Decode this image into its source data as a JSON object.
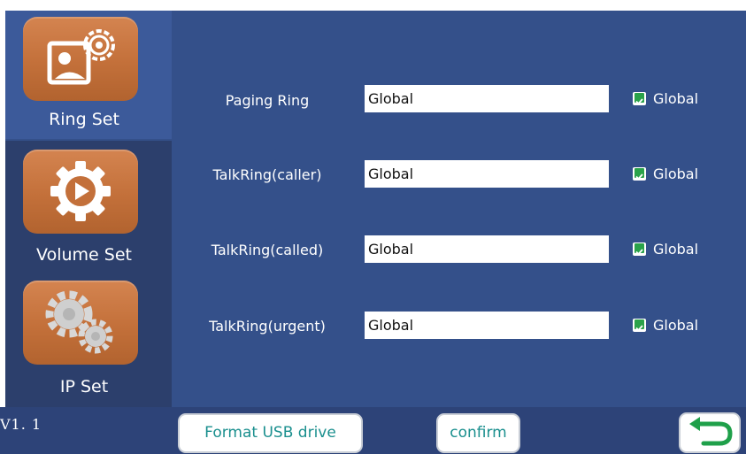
{
  "sidebar": {
    "items": [
      {
        "label": "Ring Set",
        "icon": "picture-gear-icon"
      },
      {
        "label": "Volume Set",
        "icon": "play-gear-icon"
      },
      {
        "label": "IP Set",
        "icon": "gears-icon"
      }
    ]
  },
  "rows": [
    {
      "label": "Paging Ring",
      "value": "Global",
      "checkbox_label": "Global",
      "checked": true
    },
    {
      "label": "TalkRing(caller)",
      "value": "Global",
      "checkbox_label": "Global",
      "checked": true
    },
    {
      "label": "TalkRing(called)",
      "value": "Global",
      "checkbox_label": "Global",
      "checked": true
    },
    {
      "label": "TalkRing(urgent)",
      "value": "Global",
      "checkbox_label": "Global",
      "checked": true
    }
  ],
  "footer": {
    "version": "V1. 1",
    "format_usb_label": "Format USB drive",
    "confirm_label": "confirm",
    "back_icon": "back-arrow-icon"
  },
  "colors": {
    "background": "#34508a",
    "tile": "#c3703a",
    "check": "#2aa24a",
    "button_text": "#1a8f8e"
  }
}
